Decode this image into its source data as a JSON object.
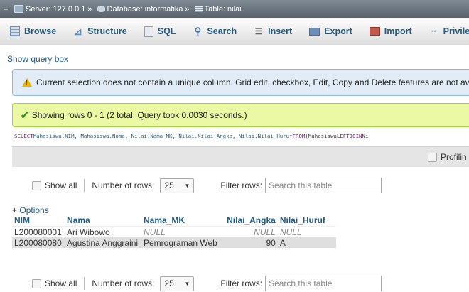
{
  "breadcrumb": {
    "server": "Server: 127.0.0.1",
    "database": "Database: informatika",
    "table": "Table: nilai",
    "separator": "»"
  },
  "tabs": [
    {
      "label": "Browse",
      "icon": "browse-icon"
    },
    {
      "label": "Structure",
      "icon": "structure-icon"
    },
    {
      "label": "SQL",
      "icon": "sql-icon"
    },
    {
      "label": "Search",
      "icon": "search-icon"
    },
    {
      "label": "Insert",
      "icon": "insert-icon"
    },
    {
      "label": "Export",
      "icon": "export-icon"
    },
    {
      "label": "Import",
      "icon": "import-icon"
    },
    {
      "label": "Privile",
      "icon": "privileges-icon"
    }
  ],
  "show_query_box": "Show query box",
  "notice": "Current selection does not contain a unique column. Grid edit, checkbox, Edit, Copy and Delete features are not av",
  "success": "Showing rows 0 - 1 (2 total, Query took 0.0030 seconds.)",
  "sql": {
    "select_kw": "SELECT",
    "columns": " Mahasiswa.NIM, Mahasiswa.Nama, Nilai.Nama_MK, Nilai.Nilai_Angka, Nilai.Nilai_Huruf ",
    "from_kw": "FROM",
    "from_rest": " (Mahasiswa ",
    "left_kw": "LEFT",
    "join_kw": " JOIN",
    "tail": " Ni"
  },
  "profiling_label": "Profilin",
  "nav": {
    "show_all": "Show all",
    "number_of_rows_label": "Number of rows:",
    "rows_value": "25",
    "filter_label": "Filter rows:",
    "filter_placeholder": "Search this table"
  },
  "options_plus": "+",
  "options_label": "Options",
  "table": {
    "headers": [
      "NIM",
      "Nama",
      "Nama_MK",
      "Nilai_Angka",
      "Nilai_Huruf"
    ],
    "rows": [
      [
        "L200080001",
        "Ari Wibowo",
        "NULL",
        "NULL",
        "NULL"
      ],
      [
        "L200080080",
        "Agustina Anggraini",
        "Pemrograman Web",
        "90",
        "A"
      ]
    ]
  },
  "colors": {
    "link": "#235a81",
    "notice_bg": "#e1ecf7",
    "success_bg": "#ebf8a4",
    "sql_keyword": "#990099"
  }
}
